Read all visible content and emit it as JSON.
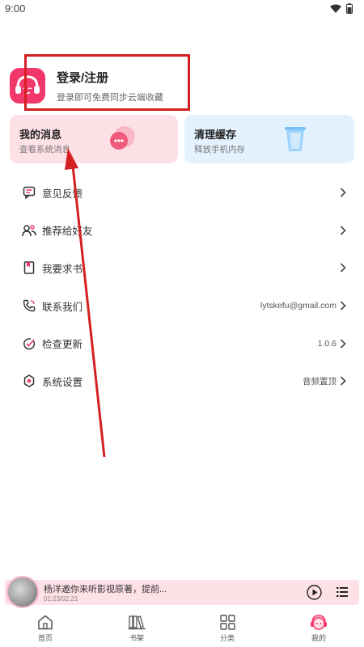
{
  "status_bar": {
    "time": "9:00",
    "wifi_icon": "wifi-icon",
    "battery_icon": "battery-icon"
  },
  "login": {
    "title": "登录/注册",
    "subtitle": "登录即可免费同步云端收藏",
    "avatar_icon": "headphones-mascot-icon"
  },
  "tiles": [
    {
      "title": "我的消息",
      "subtitle": "查看系统消息",
      "icon": "message-bubbles-icon",
      "color": "#fde1e7"
    },
    {
      "title": "清理缓存",
      "subtitle": "释放手机内存",
      "icon": "cache-cup-icon",
      "color": "#e3f2fe"
    }
  ],
  "menu": [
    {
      "label": "意见反馈",
      "value": "",
      "icon": "feedback-icon"
    },
    {
      "label": "推荐给好友",
      "value": "",
      "icon": "share-friends-icon"
    },
    {
      "label": "我要求书",
      "value": "",
      "icon": "book-request-icon"
    },
    {
      "label": "联系我们",
      "value": "lytskefu@gmail.com",
      "icon": "phone-icon"
    },
    {
      "label": "检查更新",
      "value": "1.0.6",
      "icon": "update-icon"
    },
    {
      "label": "系统设置",
      "value": "音频置顶",
      "icon": "settings-icon"
    }
  ],
  "player": {
    "title": "杨洋邀你来听影视原著，提前...",
    "time": "01:23/02:21",
    "play_icon": "play-icon",
    "list_icon": "playlist-icon"
  },
  "tabs": [
    {
      "label": "首页",
      "icon": "home-icon"
    },
    {
      "label": "书架",
      "icon": "bookshelf-icon"
    },
    {
      "label": "分类",
      "icon": "category-grid-icon"
    },
    {
      "label": "我的",
      "icon": "profile-mascot-icon",
      "active": true
    }
  ],
  "colors": {
    "accent": "#f2386a",
    "annotation": "#d42020"
  }
}
